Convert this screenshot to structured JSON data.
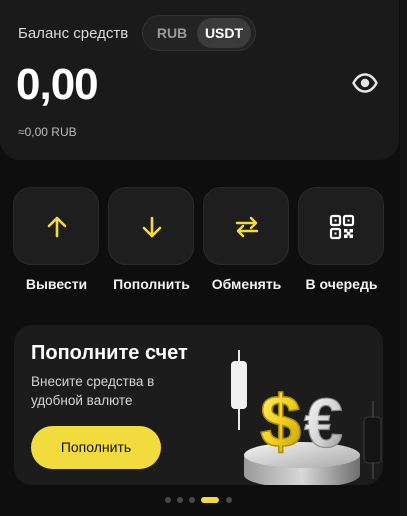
{
  "balance": {
    "label": "Баланс средств",
    "currencies": [
      "RUB",
      "USDT"
    ],
    "selected_currency": "USDT",
    "amount": "0,00",
    "converted": "≈0,00 RUB",
    "visibility_icon": "eye-icon"
  },
  "actions": [
    {
      "label": "Вывести",
      "icon": "arrow-up-icon"
    },
    {
      "label": "Пополнить",
      "icon": "arrow-down-icon"
    },
    {
      "label": "Обменять",
      "icon": "exchange-icon"
    },
    {
      "label": "В очередь",
      "icon": "qr-code-icon"
    }
  ],
  "promo": {
    "title": "Пополните счет",
    "text": "Внесите средства в удобной валюте",
    "button_label": "Пополнить",
    "illustration": "dollar-euro-podium-illustration"
  },
  "pager": {
    "count": 5,
    "active_index": 3
  },
  "colors": {
    "accent": "#f2dc3d",
    "background": "#0e0e0e",
    "card": "#1a1a1a"
  }
}
